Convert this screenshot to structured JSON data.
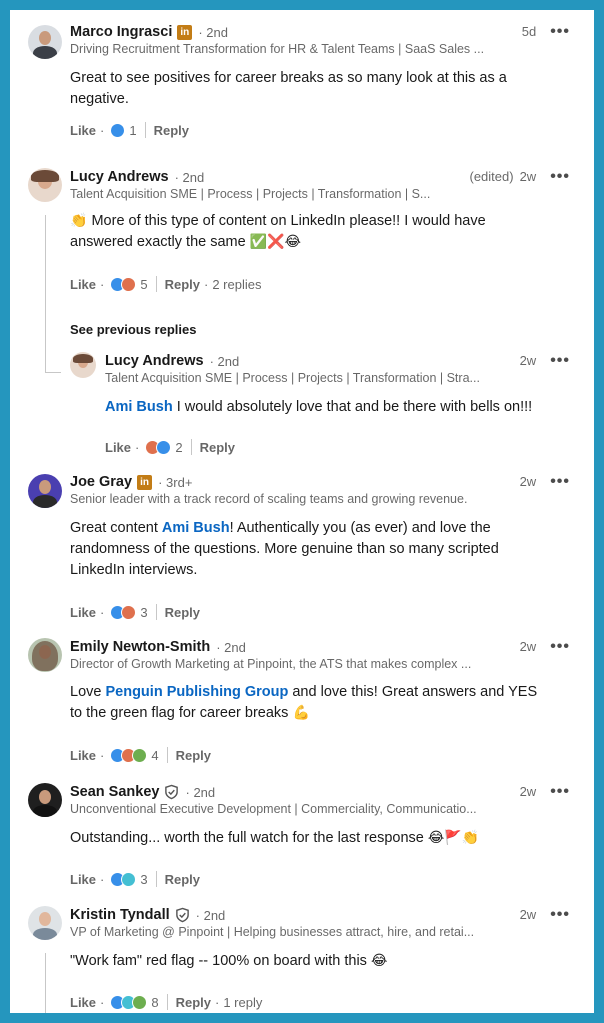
{
  "colors": {
    "frame": "#2596be",
    "mention": "#0a66c2",
    "premium_badge": "#c37d16"
  },
  "actions": {
    "like": "Like",
    "reply": "Reply",
    "see_previous": "See previous replies"
  },
  "comments": [
    {
      "name": "Marco Ingrasci",
      "badge": "in",
      "degree": "2nd",
      "time": "5d",
      "headline": "Driving Recruitment Transformation for HR & Talent Teams | SaaS Sales ...",
      "text": "Great to see positives for career breaks as so many look at this as a negative.",
      "reactions": [
        "like-reaction"
      ],
      "reaction_count": "1"
    },
    {
      "name": "Lucy Andrews",
      "degree": "2nd",
      "edited": "(edited)",
      "time": "2w",
      "headline": "Talent Acquisition SME | Process | Projects | Transformation | S...",
      "text_emoji_start": "👏",
      "text": "More of this type of content on LinkedIn please!! I would have answered exactly the same",
      "text_emoji_end": "✅❌😂",
      "reactions": [
        "like-reaction",
        "love-reaction"
      ],
      "reaction_count": "5",
      "replies": "2 replies"
    },
    {
      "name": "Lucy Andrews",
      "degree": "2nd",
      "time": "2w",
      "headline": "Talent Acquisition SME | Process | Projects | Transformation | Stra...",
      "mention": "Ami Bush",
      "text": "I would absolutely love that and be there with bells on!!!",
      "reactions": [
        "love-reaction",
        "like-reaction"
      ],
      "reaction_count": "2"
    },
    {
      "name": "Joe Gray",
      "badge": "in",
      "degree": "3rd+",
      "time": "2w",
      "headline": "Senior leader with a track record of scaling teams and growing revenue.",
      "text_before": "Great content ",
      "mention": "Ami Bush",
      "text": "! Authentically you (as ever) and love the randomness of the questions. More genuine than so many scripted LinkedIn interviews.",
      "reactions": [
        "like-reaction",
        "love-reaction"
      ],
      "reaction_count": "3"
    },
    {
      "name": "Emily Newton-Smith",
      "degree": "2nd",
      "time": "2w",
      "headline": "Director of Growth Marketing at Pinpoint, the ATS that makes complex ...",
      "text_before": "Love ",
      "mention": "Penguin Publishing Group",
      "text": " and love this! Great answers and YES to the green flag for career breaks",
      "text_emoji_end": "💪",
      "reactions": [
        "like-reaction",
        "love-reaction",
        "celebrate-reaction"
      ],
      "reaction_count": "4"
    },
    {
      "name": "Sean Sankey",
      "badge": "verified",
      "degree": "2nd",
      "time": "2w",
      "headline": "Unconventional Executive Development | Commerciality, Communicatio...",
      "text": "Outstanding... worth the full watch for the last response",
      "text_emoji_end": "😂🚩👏",
      "reactions": [
        "like-reaction",
        "funny-reaction"
      ],
      "reaction_count": "3"
    },
    {
      "name": "Kristin Tyndall",
      "badge": "verified",
      "degree": "2nd",
      "time": "2w",
      "headline": "VP of Marketing @ Pinpoint | Helping businesses attract, hire, and retai...",
      "text": "\"Work fam\" red flag -- 100% on board with this",
      "text_emoji_end": "😂",
      "reactions": [
        "like-reaction",
        "funny-reaction",
        "celebrate-reaction"
      ],
      "reaction_count": "8",
      "replies": "1 reply"
    }
  ]
}
